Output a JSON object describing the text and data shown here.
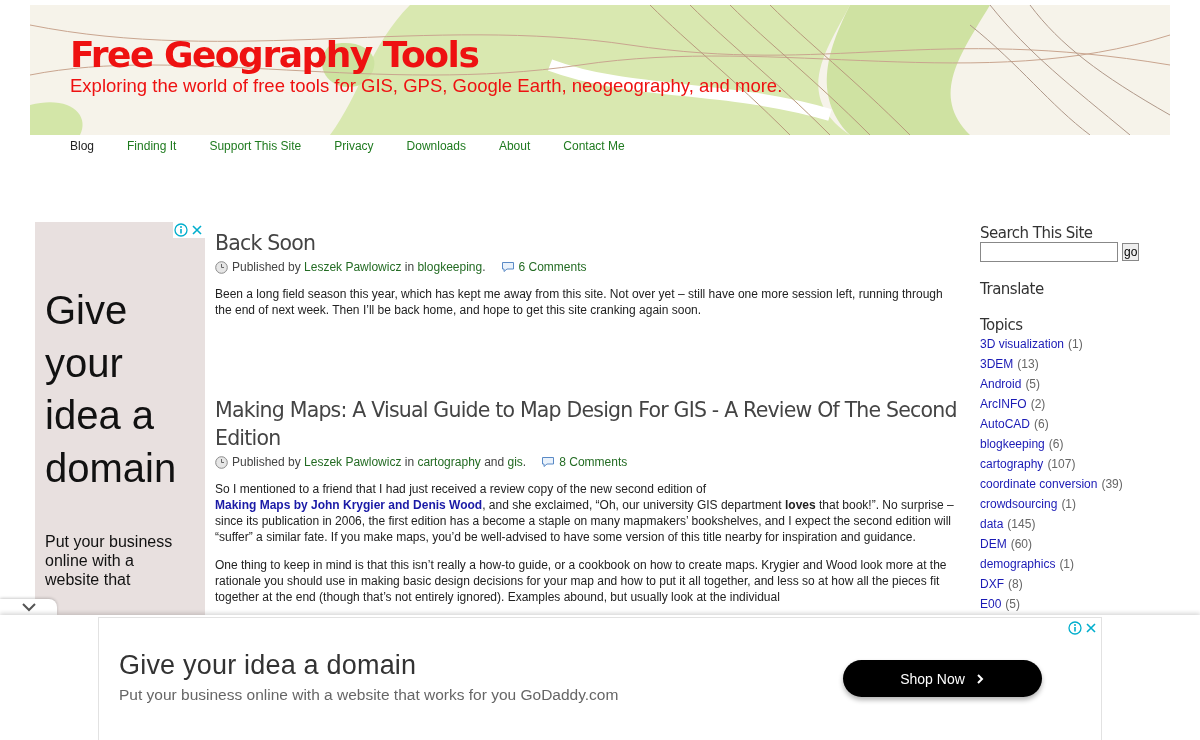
{
  "header": {
    "title": "Free Geography Tools",
    "tagline": "Exploring the world of free tools for GIS, GPS, Google Earth, neogeography, and more."
  },
  "nav": [
    {
      "label": "Blog",
      "selected": true
    },
    {
      "label": "Finding It",
      "selected": false
    },
    {
      "label": "Support This Site",
      "selected": false
    },
    {
      "label": "Privacy",
      "selected": false
    },
    {
      "label": "Downloads",
      "selected": false
    },
    {
      "label": "About",
      "selected": false
    },
    {
      "label": "Contact Me",
      "selected": false
    }
  ],
  "side_ad": {
    "headline": "Give your idea a domain",
    "body": "Put your business online with a website that"
  },
  "posts": [
    {
      "title": "Back Soon",
      "meta": [
        {
          "text": "Published by ",
          "kind": "plain"
        },
        {
          "text": "Leszek Pawlowicz",
          "kind": "link"
        },
        {
          "text": " in ",
          "kind": "plain"
        },
        {
          "text": "blogkeeping",
          "kind": "link"
        },
        {
          "text": ".",
          "kind": "plain"
        }
      ],
      "comments": "6 Comments",
      "paragraphs": [
        [
          {
            "text": "Been a long field season this year, which has kept me away from this site. Not over yet – still have one more session left, running through the end of next week. Then I’ll be back home, and hope to get this site cranking again soon.",
            "kind": "plain"
          }
        ]
      ]
    },
    {
      "title": "Making Maps: A Visual Guide to Map Design For GIS - A Review Of The Second Edition",
      "meta": [
        {
          "text": "Published by ",
          "kind": "plain"
        },
        {
          "text": "Leszek Pawlowicz",
          "kind": "link"
        },
        {
          "text": " in ",
          "kind": "plain"
        },
        {
          "text": "cartography",
          "kind": "link"
        },
        {
          "text": " and ",
          "kind": "plain"
        },
        {
          "text": "gis",
          "kind": "link"
        },
        {
          "text": ".",
          "kind": "plain"
        }
      ],
      "comments": "8 Comments",
      "paragraphs": [
        [
          {
            "text": "So I mentioned to a friend that I had just received a review copy of the new second edition of ",
            "kind": "plain"
          },
          {
            "text": "Making Maps by John Krygier and Denis Wood",
            "kind": "link"
          },
          {
            "text": ", and she exclaimed, “Oh, our university GIS department **loves** that book!”. No surprise – since its publication in 2006, the first edition has a become a staple on many mapmakers’ bookshelves, and I expect the second edition will “suffer” a similar fate. If you make maps, you’d be well-advised to have some version of this title nearby for inspiration and guidance.",
            "kind": "plain"
          }
        ],
        [
          {
            "text": "One thing to keep in mind is that this isn’t really a how-to guide, or a cookbook on how to create maps. Krygier and Wood look more at the rationale you should use in making basic design decisions for your map and how to put it all together, and less so at how all the pieces fit together at the end (though that’s not entirely ignored). Examples abound, but usually look at the individual",
            "kind": "plain"
          }
        ]
      ]
    }
  ],
  "sidebar": {
    "search_title": "Search This Site",
    "search_button": "go",
    "translate_title": "Translate",
    "topics_title": "Topics",
    "topics": [
      {
        "name": "3D visualization",
        "count": "(1)"
      },
      {
        "name": "3DEM",
        "count": "(13)"
      },
      {
        "name": "Android",
        "count": "(5)"
      },
      {
        "name": "ArcINFO",
        "count": "(2)"
      },
      {
        "name": "AutoCAD",
        "count": "(6)"
      },
      {
        "name": "blogkeeping",
        "count": "(6)"
      },
      {
        "name": "cartography",
        "count": "(107)"
      },
      {
        "name": "coordinate conversion",
        "count": "(39)"
      },
      {
        "name": "crowdsourcing",
        "count": "(1)"
      },
      {
        "name": "data",
        "count": "(145)"
      },
      {
        "name": "DEM",
        "count": "(60)"
      },
      {
        "name": "demographics",
        "count": "(1)"
      },
      {
        "name": "DXF",
        "count": "(8)"
      },
      {
        "name": "E00",
        "count": "(5)"
      }
    ]
  },
  "bottom_ad": {
    "headline": "Give your idea a domain",
    "body": "Put your business online with a website that works for you GoDaddy.com",
    "button": "Shop Now"
  }
}
